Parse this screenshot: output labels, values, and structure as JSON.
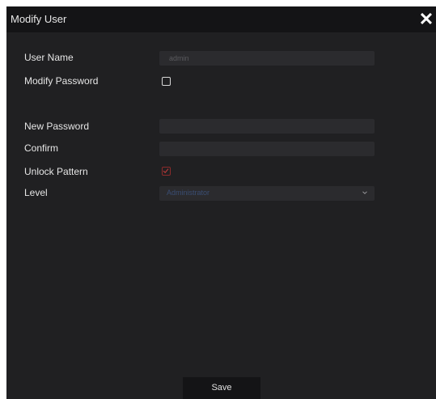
{
  "dialog": {
    "title": "Modify User",
    "close_glyph": "✕"
  },
  "form": {
    "user_name": {
      "label": "User Name",
      "value": "admin"
    },
    "modify_password": {
      "label": "Modify Password",
      "checked": false
    },
    "new_password": {
      "label": "New Password",
      "value": ""
    },
    "confirm": {
      "label": "Confirm",
      "value": ""
    },
    "unlock_pattern": {
      "label": "Unlock Pattern",
      "checked": true
    },
    "level": {
      "label": "Level",
      "value": "Administrator"
    }
  },
  "actions": {
    "save_label": "Save"
  },
  "colors": {
    "dialog_bg": "#202022",
    "titlebar_bg": "#141416",
    "field_bg": "#2b2b2e",
    "checked_accent": "#8c2b2b",
    "level_value_text": "#3a4d73"
  },
  "icons": {
    "close": "close-icon",
    "check": "check-icon",
    "dropdown": "chevron-down-icon"
  }
}
